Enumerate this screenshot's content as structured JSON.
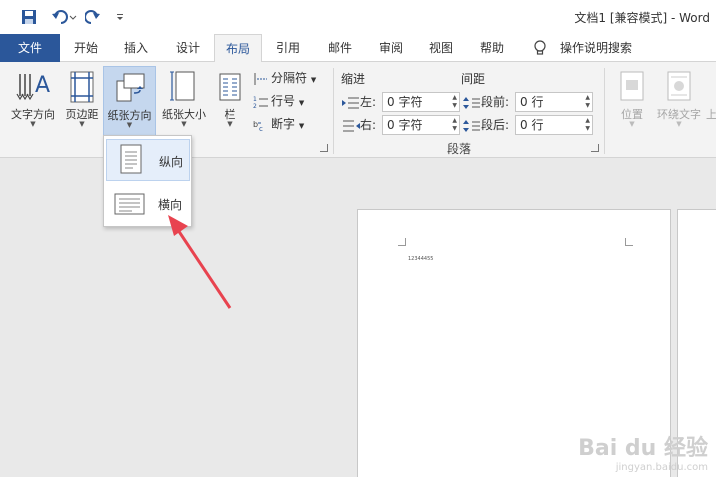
{
  "titlebar": {
    "doc_title": "文档1 [兼容模式] - Word"
  },
  "tabs": [
    {
      "label": "文件"
    },
    {
      "label": "开始"
    },
    {
      "label": "插入"
    },
    {
      "label": "设计"
    },
    {
      "label": "布局"
    },
    {
      "label": "引用"
    },
    {
      "label": "邮件"
    },
    {
      "label": "审阅"
    },
    {
      "label": "视图"
    },
    {
      "label": "帮助"
    },
    {
      "label": "操作说明搜索"
    }
  ],
  "ribbon": {
    "page_setup": {
      "text_direction": "文字方向",
      "margins": "页边距",
      "orientation": "纸张方向",
      "size": "纸张大小",
      "columns": "栏",
      "breaks": "分隔符",
      "line_numbers": "行号",
      "hyphenation": "断字"
    },
    "paragraph": {
      "indent_title": "缩进",
      "spacing_title": "间距",
      "left_label": "左:",
      "left_value": "0 字符",
      "right_label": "右:",
      "right_value": "0 字符",
      "before_label": "段前:",
      "before_value": "0 行",
      "after_label": "段后:",
      "after_value": "0 行",
      "group_label": "段落"
    },
    "arrange": {
      "position": "位置",
      "wrap_text": "环绕文字",
      "bring_forward": "上"
    }
  },
  "dropdown": {
    "portrait": "纵向",
    "landscape": "横向"
  },
  "document": {
    "text": "12344455"
  },
  "watermark": {
    "logo": "Bai du 经验",
    "url": "jingyan.baidu.com"
  },
  "colors": {
    "accent": "#2b579a",
    "arrow": "#e8434f"
  }
}
